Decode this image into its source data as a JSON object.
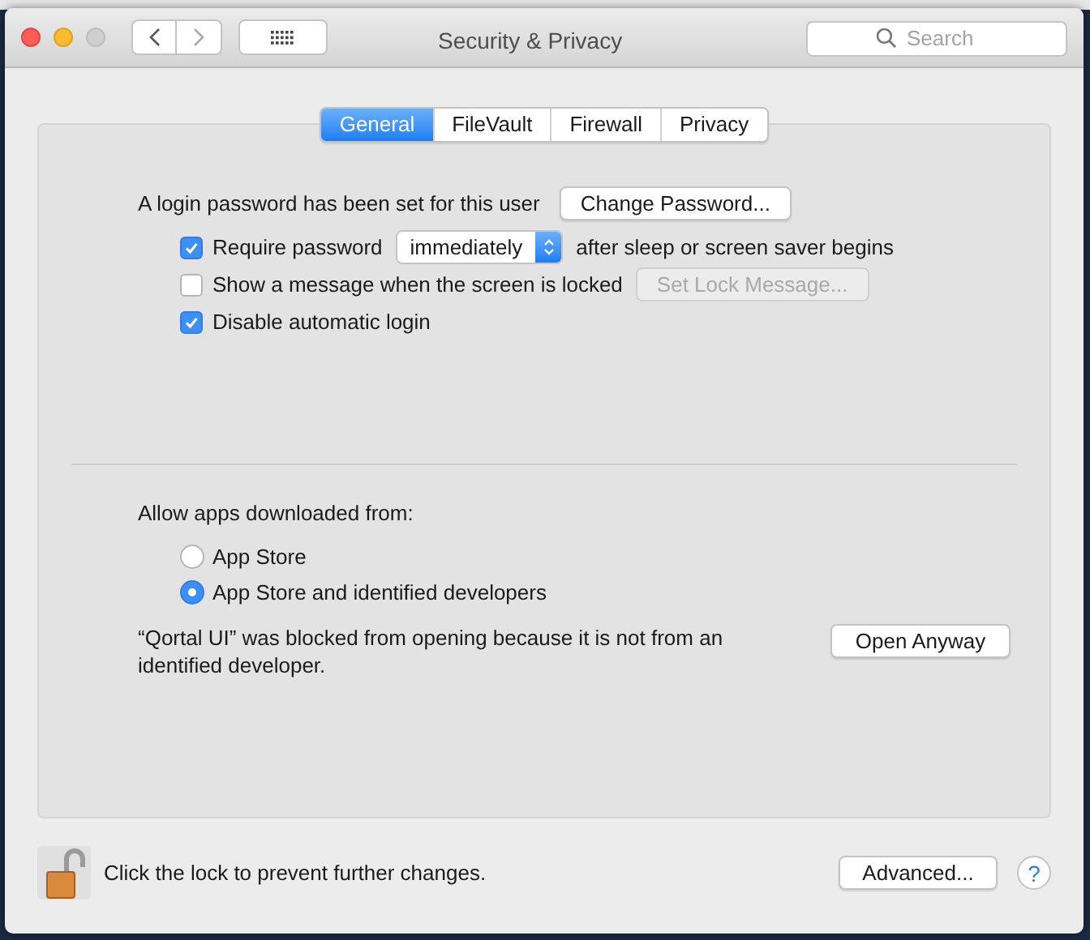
{
  "window": {
    "title": "Security & Privacy"
  },
  "search": {
    "placeholder": "Search"
  },
  "tabs": [
    {
      "label": "General",
      "selected": true
    },
    {
      "label": "FileVault",
      "selected": false
    },
    {
      "label": "Firewall",
      "selected": false
    },
    {
      "label": "Privacy",
      "selected": false
    }
  ],
  "password": {
    "label": "A login password has been set for this user",
    "button": "Change Password..."
  },
  "options": [
    {
      "kind": "select",
      "label": "Require password",
      "checked": true,
      "value": "immediately",
      "suffix": "after sleep or screen saver begins"
    },
    {
      "kind": "button",
      "label": "Show a message when the screen is locked",
      "checked": false,
      "button": "Set Lock Message...",
      "disabled": true
    },
    {
      "kind": "plain",
      "label": "Disable automatic login",
      "checked": true
    }
  ],
  "allow": {
    "label": "Allow apps downloaded from:",
    "options": [
      {
        "label": "App Store",
        "selected": false
      },
      {
        "label": "App Store and identified developers",
        "selected": true
      }
    ]
  },
  "blocked": {
    "message": "“Qortal UI” was blocked from opening because it is not from an identified developer.",
    "button": "Open Anyway"
  },
  "footer": {
    "lock_text": "Click the lock to prevent further changes.",
    "locked": false,
    "button": "Advanced...",
    "help": "?"
  }
}
